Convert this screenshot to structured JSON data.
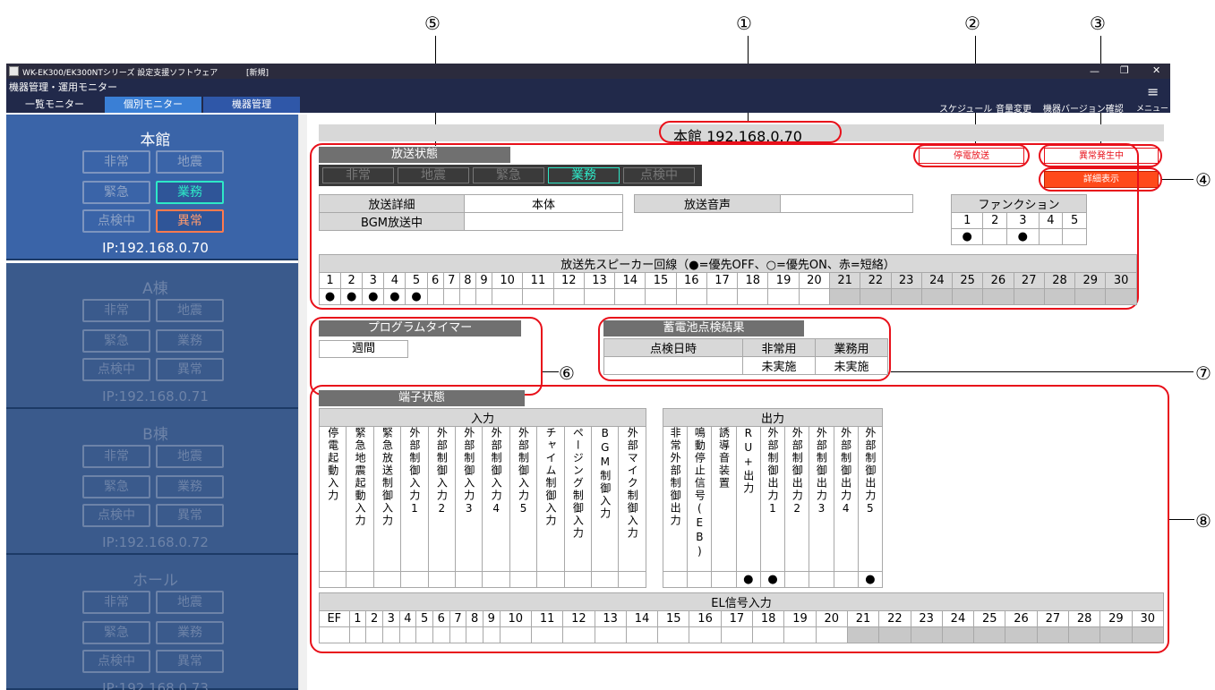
{
  "callouts": [
    "⑤",
    "①",
    "②",
    "③",
    "④",
    "⑥",
    "⑦",
    "⑧"
  ],
  "window": {
    "title": "WK-EK300/EK300NTシリーズ 設定支援ソフトウェア",
    "mode": "[新規]",
    "minimize": "—",
    "restore": "❐",
    "close": "✕"
  },
  "menu": {
    "section": "機器管理・運用モニター",
    "tabs": [
      "一覧モニター",
      "個別モニター",
      "機器管理"
    ],
    "right": [
      "スケジュール",
      "音量変更",
      "機器バージョン確認"
    ],
    "menu_label": "メニュー",
    "menu_icon": "≡"
  },
  "buildings": [
    {
      "name": "本館",
      "buttons": [
        "非常",
        "地震",
        "緊急",
        "業務",
        "点検中",
        "異常"
      ],
      "ip": "IP:192.168.0.70"
    },
    {
      "name": "A棟",
      "buttons": [
        "非常",
        "地震",
        "緊急",
        "業務",
        "点検中",
        "異常"
      ],
      "ip": "IP:192.168.0.71"
    },
    {
      "name": "B棟",
      "buttons": [
        "非常",
        "地震",
        "緊急",
        "業務",
        "点検中",
        "異常"
      ],
      "ip": "IP:192.168.0.72"
    },
    {
      "name": "ホール",
      "buttons": [
        "非常",
        "地震",
        "緊急",
        "業務",
        "点検中",
        "異常"
      ],
      "ip": "IP:192.168.0.73"
    }
  ],
  "main": {
    "title": "本館 192.168.0.70",
    "status_buttons": {
      "power": "停電放送",
      "error": "異常発生中",
      "detail": "詳細表示"
    },
    "broadcast": {
      "header": "放送状態",
      "modes": [
        "非常",
        "地震",
        "緊急",
        "業務",
        "点検中"
      ],
      "detail_label": "放送詳細",
      "detail_value": "本体",
      "bgm_label": "BGM放送中",
      "bgm_value": "",
      "audio_label": "放送音声",
      "audio_value": ""
    },
    "function": {
      "header": "ファンクション",
      "cols": [
        "1",
        "2",
        "3",
        "4",
        "5"
      ],
      "marks": [
        "●",
        "",
        "●",
        "",
        ""
      ]
    },
    "speakers": {
      "header": "放送先スピーカー回線（●=優先OFF、○=優先ON、赤=短絡）",
      "cols": [
        "1",
        "2",
        "3",
        "4",
        "5",
        "6",
        "7",
        "8",
        "9",
        "10",
        "11",
        "12",
        "13",
        "14",
        "15",
        "16",
        "17",
        "18",
        "19",
        "20",
        "21",
        "22",
        "23",
        "24",
        "25",
        "26",
        "27",
        "28",
        "29",
        "30"
      ],
      "marks": [
        "●",
        "●",
        "●",
        "●",
        "●",
        "",
        "",
        "",
        "",
        "",
        "",
        "",
        "",
        "",
        "",
        "",
        "",
        "",
        "",
        "",
        "",
        "",
        "",
        "",
        "",
        "",
        "",
        "",
        "",
        ""
      ]
    },
    "timer": {
      "header": "プログラムタイマー",
      "value": "週間"
    },
    "battery": {
      "header": "蓄電池点検結果",
      "col_date": "点検日時",
      "col_emg": "非常用",
      "col_biz": "業務用",
      "date": "",
      "emg": "未実施",
      "biz": "未実施"
    },
    "terminal": {
      "header": "端子状態",
      "input_header": "入力",
      "output_header": "出力",
      "inputs": [
        "停電起動入力",
        "緊急地震起動入力",
        "緊急放送制御入力",
        "外部制御入力1",
        "外部制御入力2",
        "外部制御入力3",
        "外部制御入力4",
        "外部制御入力5",
        "チャイム制御入力",
        "ページング制御入力",
        "BGM制御入力",
        "外部マイク制御入力"
      ],
      "input_marks": [
        "",
        "",
        "",
        "",
        "",
        "",
        "",
        "",
        "",
        "",
        "",
        ""
      ],
      "outputs": [
        "非常外部制御出力",
        "鳴動停止信号(EB)",
        "誘導音装置",
        "RU+出力",
        "外部制御出力1",
        "外部制御出力2",
        "外部制御出力3",
        "外部制御出力4",
        "外部制御出力5"
      ],
      "output_marks": [
        "",
        "",
        "",
        "●",
        "●",
        "",
        "",
        "",
        "●"
      ],
      "el_header": "EL信号入力",
      "el_cols": [
        "EF",
        "1",
        "2",
        "3",
        "4",
        "5",
        "6",
        "7",
        "8",
        "9",
        "10",
        "11",
        "12",
        "13",
        "14",
        "15",
        "16",
        "17",
        "18",
        "19",
        "20",
        "21",
        "22",
        "23",
        "24",
        "25",
        "26",
        "27",
        "28",
        "29",
        "30"
      ]
    }
  }
}
